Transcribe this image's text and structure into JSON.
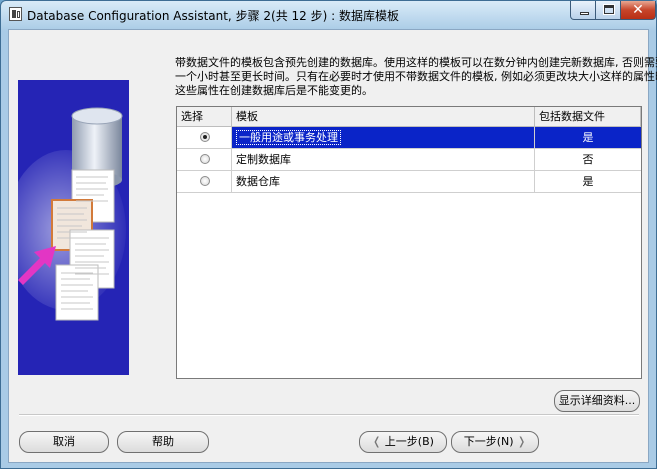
{
  "window": {
    "title": "Database Configuration Assistant, 步骤 2(共 12 步) : 数据库模板",
    "minimize": "_",
    "maximize": "□",
    "close": "✕"
  },
  "description": {
    "line1": "带数据文件的模板包含预先创建的数据库。使用这样的模板可以在数分钟内创建完新数据库, 否则需要",
    "line2": "一个小时甚至更长时间。只有在必要时才使用不带数据文件的模板, 例如必须更改块大小这样的属性时,",
    "line3": "这些属性在创建数据库后是不能变更的。"
  },
  "table": {
    "headers": {
      "select": "选择",
      "template": "模板",
      "includes_datafiles": "包括数据文件"
    },
    "rows": [
      {
        "template": "一般用途或事务处理",
        "includes_datafiles": "是",
        "selected": true
      },
      {
        "template": "定制数据库",
        "includes_datafiles": "否",
        "selected": false
      },
      {
        "template": "数据仓库",
        "includes_datafiles": "是",
        "selected": false
      }
    ]
  },
  "buttons": {
    "show_details": "显示详细资料...",
    "cancel": "取消",
    "help": "帮助",
    "back": "上一步(B)",
    "next": "下一步(N)"
  },
  "colors": {
    "graphic_bg": "#2524b5",
    "selection": "#0a24c8",
    "arrow": "#e236c4"
  }
}
